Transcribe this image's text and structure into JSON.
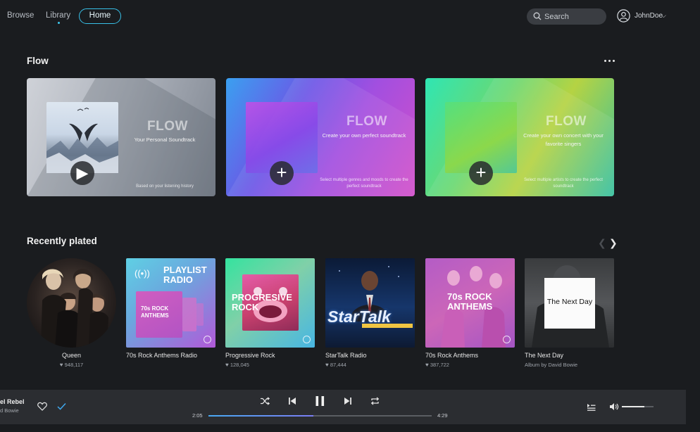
{
  "nav": {
    "browse": "Browse",
    "library": "Library",
    "home": "Home",
    "search_placeholder": "Search",
    "user_name": "JohnDoe"
  },
  "flow": {
    "title": "Flow",
    "cards": [
      {
        "logo": "FLOW",
        "description": "Your Personal Soundtrack",
        "note": "Based on your listening history",
        "action": "play"
      },
      {
        "logo": "FLOW",
        "description": "Create your own perfect soundtrack",
        "note": "Select multiple genres and moods to create the perfect soundtrack",
        "action": "add"
      },
      {
        "logo": "FLOW",
        "description": "Create your own concert with your favorite singers",
        "note": "Select multiple artists to create the perfect soundtrack",
        "action": "add"
      }
    ]
  },
  "recent": {
    "title": "Recently plated",
    "items": [
      {
        "name": "Queen",
        "likes": "948,117"
      },
      {
        "name": "70s Rock Anthems Radio",
        "art_title": "PLAYLIST RADIO",
        "art_inner": "70s ROCK ANTHEMS"
      },
      {
        "name": "Progressive Rock",
        "likes": "128,045",
        "art_title": "PROGRESIVE ROCK"
      },
      {
        "name": "StarTalk Radio",
        "likes": "87,444",
        "art_title": "StarTalk"
      },
      {
        "name": "70s Rock Anthems",
        "likes": "387,722",
        "art_title": "70s ROCK ANTHEMS"
      },
      {
        "name": "The Next Day",
        "subtitle": "Album by David Bowie",
        "art_title": "The Next Day"
      }
    ]
  },
  "player": {
    "track": "el Rebel",
    "artist": "d Bowie",
    "current_time": "2:05",
    "total_time": "4:29",
    "progress": 0.47,
    "volume": 0.7
  }
}
